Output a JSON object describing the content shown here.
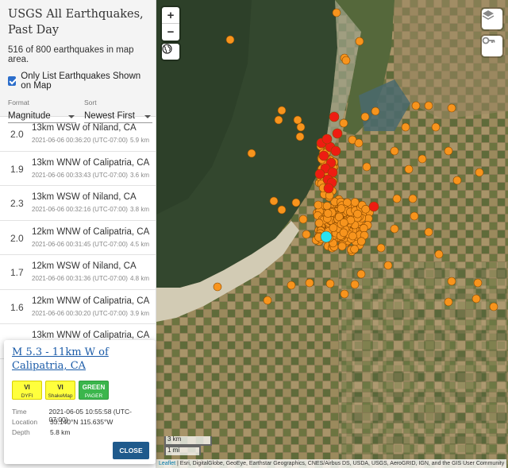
{
  "sidebar": {
    "title": "USGS All Earthquakes, Past Day",
    "count_text": "516 of 800 earthquakes in map area.",
    "only_list_label": "Only List Earthquakes Shown on Map",
    "only_list_checked": true,
    "format": {
      "label": "Format",
      "value": "Magnitude"
    },
    "sort": {
      "label": "Sort",
      "value": "Newest First"
    },
    "earthquakes": [
      {
        "mag": "2.0",
        "place": "13km WSW of Niland, CA",
        "time": "2021-06-06 00:36:20 (UTC-07:00)",
        "depth": "5.9 km"
      },
      {
        "mag": "1.9",
        "place": "13km WNW of Calipatria, CA",
        "time": "2021-06-06 00:33:43 (UTC-07:00)",
        "depth": "3.6 km"
      },
      {
        "mag": "2.3",
        "place": "13km WSW of Niland, CA",
        "time": "2021-06-06 00:32:16 (UTC-07:00)",
        "depth": "3.8 km"
      },
      {
        "mag": "2.0",
        "place": "12km WNW of Calipatria, CA",
        "time": "2021-06-06 00:31:45 (UTC-07:00)",
        "depth": "4.5 km"
      },
      {
        "mag": "1.7",
        "place": "12km WSW of Niland, CA",
        "time": "2021-06-06 00:31:36 (UTC-07:00)",
        "depth": "4.8 km"
      },
      {
        "mag": "1.6",
        "place": "12km WNW of Calipatria, CA",
        "time": "2021-06-06 00:30:20 (UTC-07:00)",
        "depth": "3.9 km"
      },
      {
        "mag": "",
        "place": "13km WNW of Calipatria, CA",
        "time": "",
        "depth": ""
      }
    ]
  },
  "popup": {
    "title": "M 5.3 - 11km W of Calipatria, CA",
    "badges": [
      {
        "top": "VI",
        "bottom": "DYFI"
      },
      {
        "top": "VI",
        "bottom": "ShakeMap"
      },
      {
        "top": "GREEN",
        "bottom": "PAGER"
      }
    ],
    "time_label": "Time",
    "time_value": "2021-06-05 10:55:58 (UTC-07:00)",
    "location_label": "Location",
    "location_value": "33.140°N 115.635°W",
    "depth_label": "Depth",
    "depth_value": "5.8 km",
    "close_label": "CLOSE"
  },
  "map": {
    "zoom_in": "+",
    "zoom_out": "−",
    "scale_km": "3 km",
    "scale_mi": "1 mi",
    "attribution_leaflet": "Leaflet",
    "attribution_text": " | Esri, DigitalGlobe, GeoEye, Earthstar Geographics, CNES/Airbus DS, USDA, USGS, AeroGRID, IGN, and the GIS User Community",
    "colors": {
      "recent": "#ee1c12",
      "day": "#f7941d",
      "selected": "#29e3f2"
    }
  }
}
